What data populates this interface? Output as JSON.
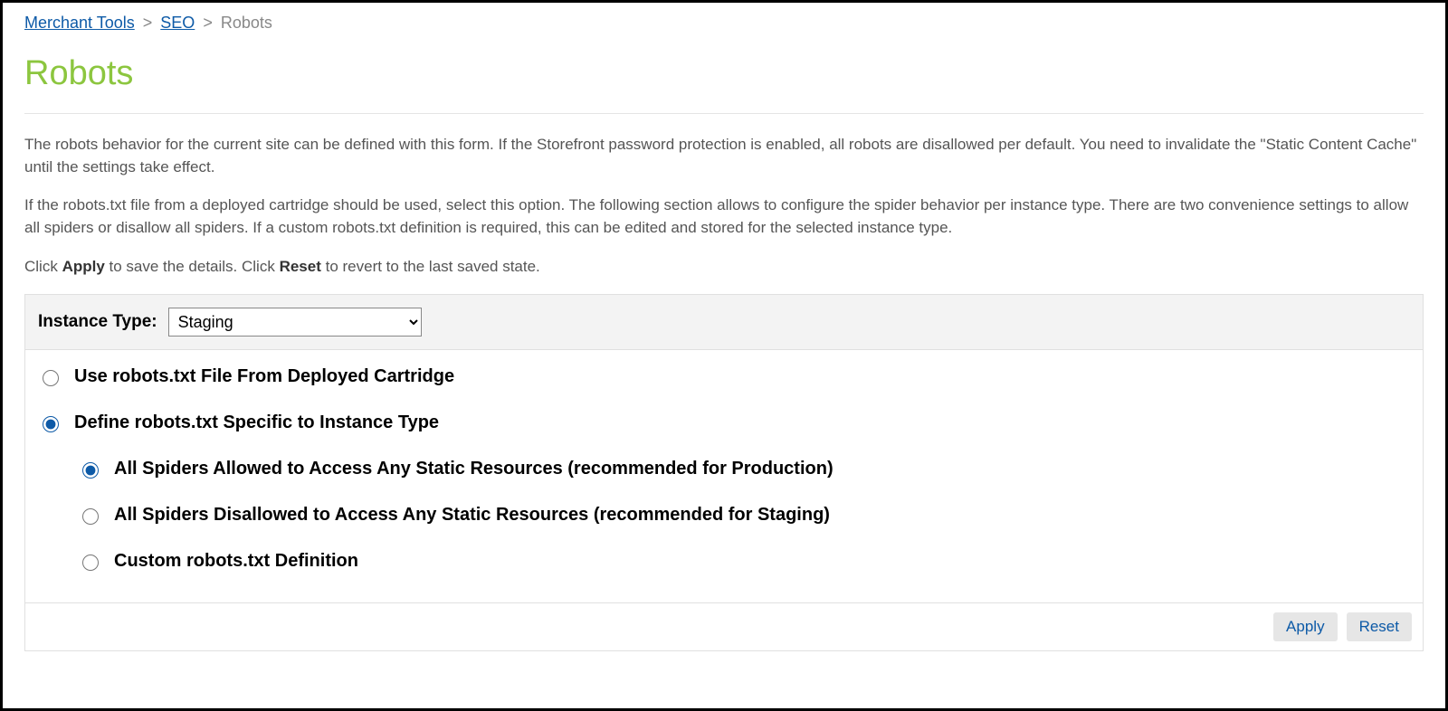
{
  "breadcrumb": {
    "items": [
      {
        "label": "Merchant Tools",
        "link": true
      },
      {
        "label": "SEO",
        "link": true
      },
      {
        "label": "Robots",
        "link": false
      }
    ],
    "separator": ">"
  },
  "page_title": "Robots",
  "description": {
    "p1": "The robots behavior for the current site can be defined with this form. If the Storefront password protection is enabled, all robots are disallowed per default. You need to invalidate the \"Static Content Cache\" until the settings take effect.",
    "p2": "If the robots.txt file from a deployed cartridge should be used, select this option. The following section allows to configure the spider behavior per instance type. There are two convenience settings to allow all spiders or disallow all spiders. If a custom robots.txt definition is required, this can be edited and stored for the selected instance type.",
    "p3_pre": "Click ",
    "p3_apply": "Apply",
    "p3_mid": " to save the details. Click ",
    "p3_reset": "Reset",
    "p3_post": " to revert to the last saved state."
  },
  "form": {
    "instance_type_label": "Instance Type:",
    "instance_type_value": "Staging",
    "options": {
      "use_cartridge": {
        "label": "Use robots.txt File From Deployed Cartridge",
        "checked": false
      },
      "define_specific": {
        "label": "Define robots.txt Specific to Instance Type",
        "checked": true
      }
    },
    "sub_options": {
      "allow_all": {
        "label": "All Spiders Allowed to Access Any Static Resources (recommended for Production)",
        "checked": true
      },
      "disallow_all": {
        "label": "All Spiders Disallowed to Access Any Static Resources (recommended for Staging)",
        "checked": false
      },
      "custom": {
        "label": "Custom robots.txt Definition",
        "checked": false
      }
    }
  },
  "buttons": {
    "apply": "Apply",
    "reset": "Reset"
  }
}
